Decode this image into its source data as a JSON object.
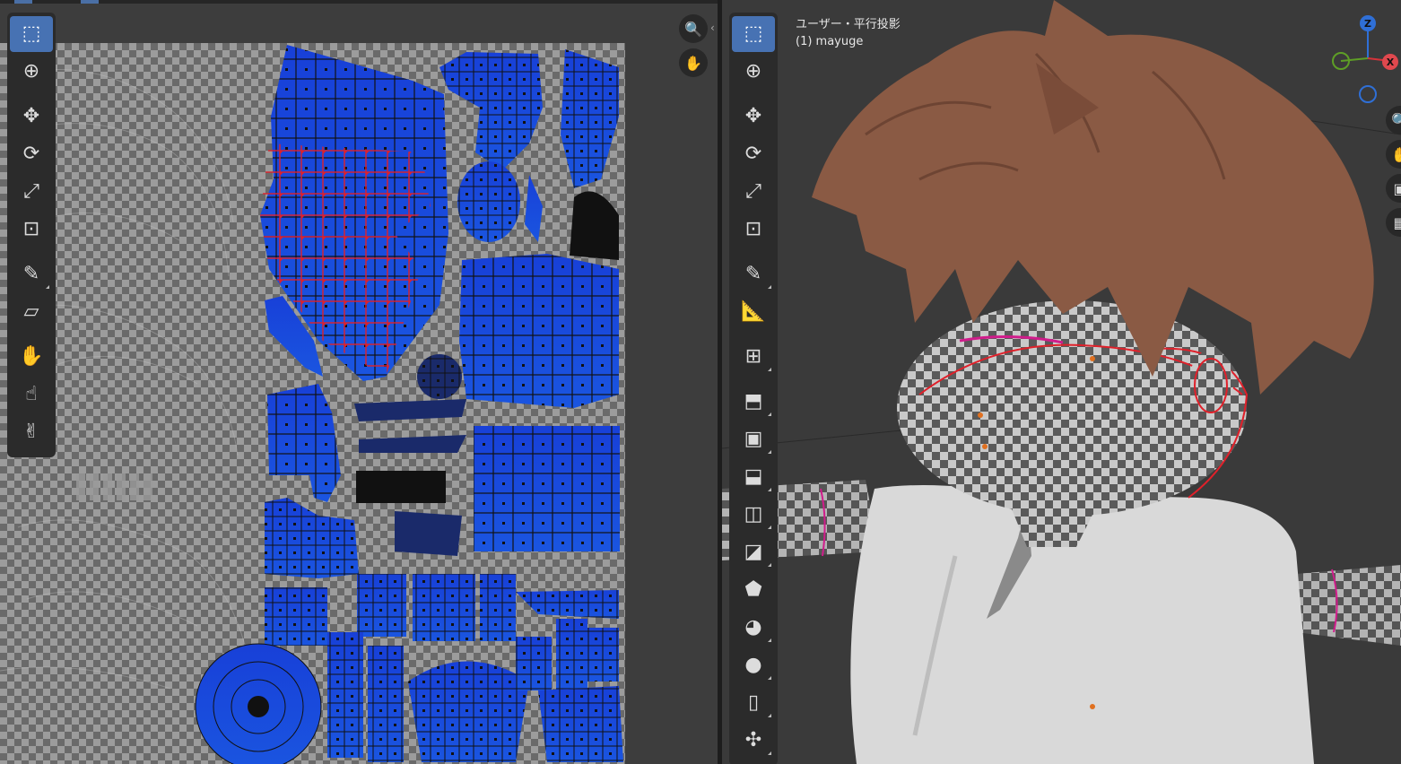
{
  "uv_editor": {
    "tools": [
      {
        "name": "select-box",
        "active": true
      },
      {
        "name": "cursor"
      },
      {
        "name": "move"
      },
      {
        "name": "rotate"
      },
      {
        "name": "scale"
      },
      {
        "name": "transform"
      },
      {
        "name": "annotate"
      },
      {
        "name": "rip-region"
      },
      {
        "name": "grab"
      },
      {
        "name": "relax"
      },
      {
        "name": "pinch"
      }
    ],
    "nav": [
      "zoom-icon",
      "pan-hand-icon"
    ]
  },
  "viewport": {
    "view_label": "ユーザー・平行投影",
    "object_label": "(1) mayuge",
    "tools": [
      {
        "name": "select-box",
        "active": true
      },
      {
        "name": "cursor"
      },
      {
        "name": "move"
      },
      {
        "name": "rotate"
      },
      {
        "name": "scale"
      },
      {
        "name": "transform"
      },
      {
        "name": "annotate"
      },
      {
        "name": "measure"
      },
      {
        "name": "add-cube"
      },
      {
        "name": "extrude"
      },
      {
        "name": "inset"
      },
      {
        "name": "bevel"
      },
      {
        "name": "loop-cut"
      },
      {
        "name": "knife"
      },
      {
        "name": "poly-build"
      },
      {
        "name": "spin"
      },
      {
        "name": "smooth"
      },
      {
        "name": "edge-slide"
      },
      {
        "name": "shrink-fatten"
      }
    ],
    "gizmo": {
      "z": "Z",
      "x": "X"
    },
    "colors": {
      "accent": "#4772b3",
      "hair": "#8a5a44",
      "selection": "#e0202a",
      "uv_island": "#1a3fd6"
    }
  }
}
